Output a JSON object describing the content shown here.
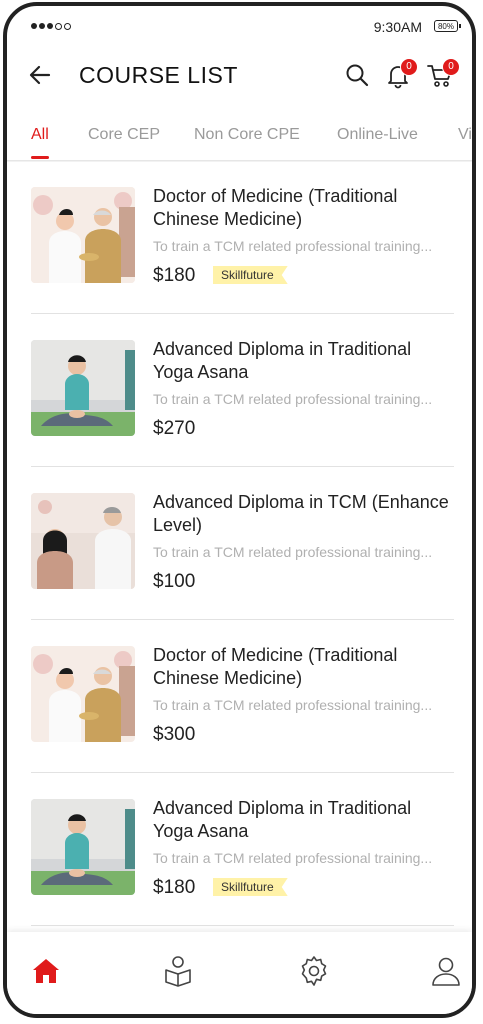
{
  "status": {
    "time": "9:30AM",
    "battery": "80%"
  },
  "header": {
    "title": "COURSE LIST",
    "notifications_count": "0",
    "cart_count": "0"
  },
  "tabs": [
    {
      "label": "All",
      "active": true
    },
    {
      "label": "Core CEP",
      "active": false
    },
    {
      "label": "Non Core CPE",
      "active": false
    },
    {
      "label": "Online-Live",
      "active": false
    },
    {
      "label": "Vi",
      "active": false
    }
  ],
  "courses": [
    {
      "title": "Doctor of Medicine (Traditional Chinese Medicine)",
      "desc": "To train a TCM related professional training...",
      "price": "$180",
      "tag": "Skillfuture",
      "image": "tcm-doctors"
    },
    {
      "title": "Advanced Diploma in Traditional Yoga Asana",
      "desc": "To train a TCM related professional training...",
      "price": "$270",
      "tag": "",
      "image": "yoga"
    },
    {
      "title": "Advanced Diploma in TCM (Enhance Level)",
      "desc": "To train a TCM related professional training...",
      "price": "$100",
      "tag": "",
      "image": "acupuncture"
    },
    {
      "title": "Doctor of Medicine (Traditional Chinese Medicine)",
      "desc": "To train a TCM related professional training...",
      "price": "$300",
      "tag": "",
      "image": "tcm-doctors"
    },
    {
      "title": "Advanced Diploma in Traditional Yoga Asana",
      "desc": "To train a TCM related professional training...",
      "price": "$180",
      "tag": "Skillfuture",
      "image": "yoga"
    }
  ],
  "bottom_nav": [
    {
      "icon": "home-icon",
      "active": true
    },
    {
      "icon": "courses-icon",
      "active": false
    },
    {
      "icon": "settings-icon",
      "active": false
    },
    {
      "icon": "profile-icon",
      "active": false
    }
  ],
  "colors": {
    "accent": "#e01b1b",
    "tag_bg": "#fff2a8",
    "muted": "#b0b0b0"
  }
}
